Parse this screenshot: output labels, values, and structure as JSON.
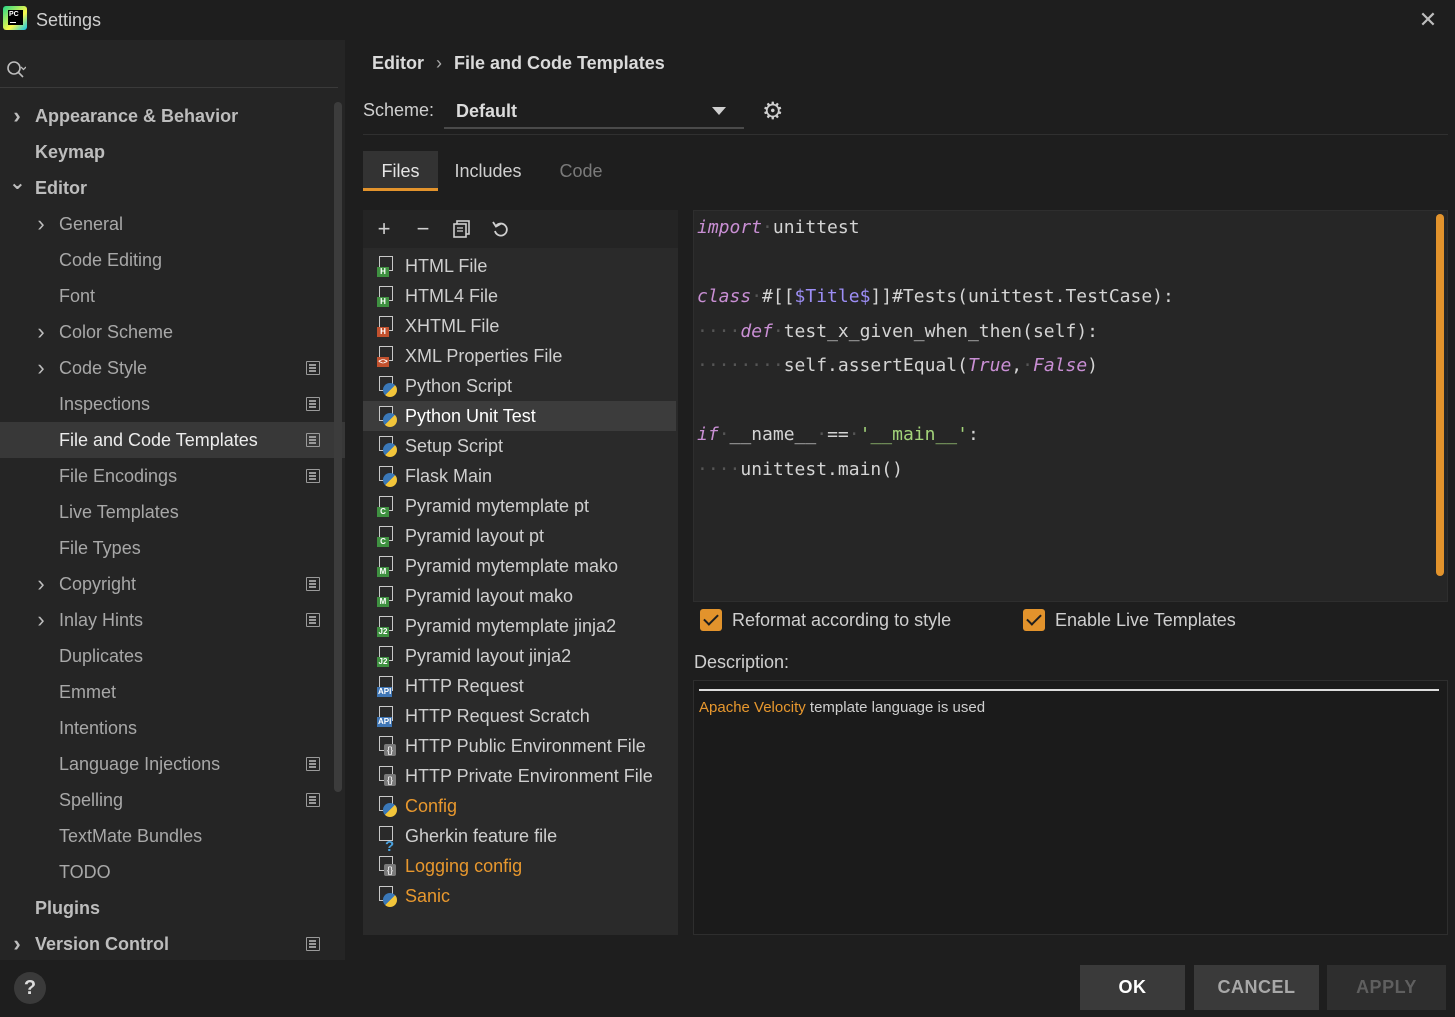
{
  "window": {
    "title": "Settings"
  },
  "sidebar": {
    "items": [
      {
        "label": "Appearance & Behavior",
        "level": 0,
        "chevron": "right"
      },
      {
        "label": "Keymap",
        "level": 0,
        "chevron": ""
      },
      {
        "label": "Editor",
        "level": 0,
        "chevron": "down"
      },
      {
        "label": "General",
        "level": 1,
        "chevron": "right"
      },
      {
        "label": "Code Editing",
        "level": 1,
        "chevron": ""
      },
      {
        "label": "Font",
        "level": 1,
        "chevron": ""
      },
      {
        "label": "Color Scheme",
        "level": 1,
        "chevron": "right"
      },
      {
        "label": "Code Style",
        "level": 1,
        "chevron": "right",
        "project": true
      },
      {
        "label": "Inspections",
        "level": 1,
        "chevron": "",
        "project": true
      },
      {
        "label": "File and Code Templates",
        "level": 1,
        "chevron": "",
        "project": true,
        "selected": true
      },
      {
        "label": "File Encodings",
        "level": 1,
        "chevron": "",
        "project": true
      },
      {
        "label": "Live Templates",
        "level": 1,
        "chevron": ""
      },
      {
        "label": "File Types",
        "level": 1,
        "chevron": ""
      },
      {
        "label": "Copyright",
        "level": 1,
        "chevron": "right",
        "project": true
      },
      {
        "label": "Inlay Hints",
        "level": 1,
        "chevron": "right",
        "project": true
      },
      {
        "label": "Duplicates",
        "level": 1,
        "chevron": ""
      },
      {
        "label": "Emmet",
        "level": 1,
        "chevron": ""
      },
      {
        "label": "Intentions",
        "level": 1,
        "chevron": ""
      },
      {
        "label": "Language Injections",
        "level": 1,
        "chevron": "",
        "project": true
      },
      {
        "label": "Spelling",
        "level": 1,
        "chevron": "",
        "project": true
      },
      {
        "label": "TextMate Bundles",
        "level": 1,
        "chevron": ""
      },
      {
        "label": "TODO",
        "level": 1,
        "chevron": ""
      },
      {
        "label": "Plugins",
        "level": 0,
        "chevron": ""
      },
      {
        "label": "Version Control",
        "level": 0,
        "chevron": "right",
        "project": true
      }
    ]
  },
  "breadcrumb": {
    "parent": "Editor",
    "separator": "›",
    "current": "File and Code Templates"
  },
  "scheme": {
    "label": "Scheme:",
    "value": "Default"
  },
  "tabs": [
    {
      "label": "Files",
      "state": "active"
    },
    {
      "label": "Includes",
      "state": "normal"
    },
    {
      "label": "Code",
      "state": "disabled"
    }
  ],
  "templates": [
    {
      "label": "HTML File",
      "icon": "html-file-icon",
      "badge": "H",
      "badge_color": "green"
    },
    {
      "label": "HTML4 File",
      "icon": "html-file-icon",
      "badge": "H",
      "badge_color": "green"
    },
    {
      "label": "XHTML File",
      "icon": "xhtml-file-icon",
      "badge": "H",
      "badge_color": "red"
    },
    {
      "label": "XML Properties File",
      "icon": "xml-file-icon",
      "badge": "<>",
      "badge_color": "red"
    },
    {
      "label": "Python Script",
      "icon": "python-file-icon",
      "kind": "py"
    },
    {
      "label": "Python Unit Test",
      "icon": "python-file-icon",
      "kind": "py",
      "selected": true
    },
    {
      "label": "Setup Script",
      "icon": "python-file-icon",
      "kind": "py"
    },
    {
      "label": "Flask Main",
      "icon": "python-file-icon",
      "kind": "py"
    },
    {
      "label": "Pyramid mytemplate pt",
      "icon": "chameleon-file-icon",
      "badge": "C",
      "badge_color": "green"
    },
    {
      "label": "Pyramid layout pt",
      "icon": "chameleon-file-icon",
      "badge": "C",
      "badge_color": "green"
    },
    {
      "label": "Pyramid mytemplate mako",
      "icon": "mako-file-icon",
      "badge": "M",
      "badge_color": "green"
    },
    {
      "label": "Pyramid layout mako",
      "icon": "mako-file-icon",
      "badge": "M",
      "badge_color": "green"
    },
    {
      "label": "Pyramid mytemplate jinja2",
      "icon": "jinja2-file-icon",
      "badge": "J2",
      "badge_color": "green"
    },
    {
      "label": "Pyramid layout jinja2",
      "icon": "jinja2-file-icon",
      "badge": "J2",
      "badge_color": "green"
    },
    {
      "label": "HTTP Request",
      "icon": "api-file-icon",
      "badge": "API",
      "badge_color": "blue"
    },
    {
      "label": "HTTP Request Scratch",
      "icon": "api-file-icon",
      "badge": "API",
      "badge_color": "blue"
    },
    {
      "label": "HTTP Public Environment File",
      "icon": "json-file-icon",
      "kind": "grey"
    },
    {
      "label": "HTTP Private Environment File",
      "icon": "json-file-icon",
      "kind": "grey"
    },
    {
      "label": "Config",
      "icon": "python-file-icon",
      "kind": "py",
      "color": "orange"
    },
    {
      "label": "Gherkin feature file",
      "icon": "gherkin-file-icon",
      "kind": "q"
    },
    {
      "label": "Logging config",
      "icon": "json-file-icon",
      "kind": "grey",
      "color": "orange"
    },
    {
      "label": "Sanic",
      "icon": "python-file-icon",
      "kind": "py",
      "color": "orange"
    }
  ],
  "editor": {
    "lines": [
      "import unittest",
      "",
      "class #[[$Title$]]#Tests(unittest.TestCase):",
      "    def test_x_given_when_then(self):",
      "        self.assertEqual(True, False)",
      "",
      "if __name__ == '__main__':",
      "    unittest.main()"
    ]
  },
  "options": {
    "reformat": {
      "label": "Reformat according to style",
      "checked": true
    },
    "live_templates": {
      "label": "Enable Live Templates",
      "checked": true
    }
  },
  "description": {
    "label": "Description:",
    "link": "Apache Velocity",
    "text": " template language is used"
  },
  "buttons": {
    "help": "?",
    "ok": "OK",
    "cancel": "CANCEL",
    "apply": "APPLY"
  },
  "colors": {
    "accent": "#e2932c",
    "background": "#1e1e1e",
    "sidebar": "#252525",
    "selection": "#383838"
  }
}
